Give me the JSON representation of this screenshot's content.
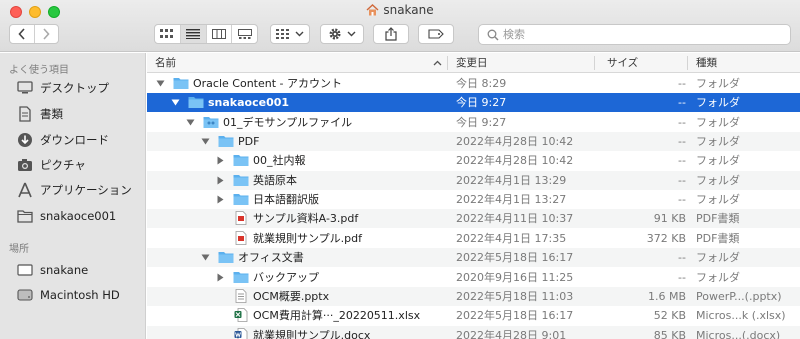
{
  "window": {
    "title": "snakane"
  },
  "toolbar": {
    "search_placeholder": "検索"
  },
  "sidebar": {
    "favorites_heading": "よく使う項目",
    "favorites": [
      {
        "label": "デスクトップ",
        "icon": "desktop-icon"
      },
      {
        "label": "書類",
        "icon": "document-icon"
      },
      {
        "label": "ダウンロード",
        "icon": "download-icon"
      },
      {
        "label": "ピクチャ",
        "icon": "camera-icon"
      },
      {
        "label": "アプリケーション",
        "icon": "applications-icon"
      },
      {
        "label": "snakaoce001",
        "icon": "folder-icon"
      }
    ],
    "locations_heading": "場所",
    "locations": [
      {
        "label": "snakane",
        "icon": "computer-icon"
      },
      {
        "label": "Macintosh HD",
        "icon": "disk-icon"
      }
    ]
  },
  "columns": {
    "name": "名前",
    "date": "変更日",
    "size": "サイズ",
    "kind": "種類"
  },
  "rows": [
    {
      "name": "Oracle Content - アカウント",
      "date": "今日 8:29",
      "size": "--",
      "kind": "フォルダ",
      "level": 0,
      "type": "folder",
      "disclosure": "open"
    },
    {
      "name": "snakaoce001",
      "date": "今日 9:27",
      "size": "--",
      "kind": "フォルダ",
      "level": 1,
      "type": "folder",
      "disclosure": "open",
      "selected": true
    },
    {
      "name": "01_デモサンプルファイル",
      "date": "今日 9:27",
      "size": "--",
      "kind": "フォルダ",
      "level": 2,
      "type": "folder-shared",
      "disclosure": "open"
    },
    {
      "name": "PDF",
      "date": "2022年4月28日 10:42",
      "size": "--",
      "kind": "フォルダ",
      "level": 3,
      "type": "folder",
      "disclosure": "open"
    },
    {
      "name": "00_社内報",
      "date": "2022年4月28日 10:42",
      "size": "--",
      "kind": "フォルダ",
      "level": 4,
      "type": "folder",
      "disclosure": "closed"
    },
    {
      "name": "英語原本",
      "date": "2022年4月1日 13:29",
      "size": "--",
      "kind": "フォルダ",
      "level": 4,
      "type": "folder",
      "disclosure": "closed"
    },
    {
      "name": "日本語翻訳版",
      "date": "2022年4月1日 13:27",
      "size": "--",
      "kind": "フォルダ",
      "level": 4,
      "type": "folder",
      "disclosure": "closed"
    },
    {
      "name": "サンプル資料A-3.pdf",
      "date": "2022年4月11日 10:37",
      "size": "91 KB",
      "kind": "PDF書類",
      "level": 4,
      "type": "pdf",
      "disclosure": "none"
    },
    {
      "name": "就業規則サンプル.pdf",
      "date": "2022年4月1日 17:35",
      "size": "372 KB",
      "kind": "PDF書類",
      "level": 4,
      "type": "pdf",
      "disclosure": "none"
    },
    {
      "name": "オフィス文書",
      "date": "2022年5月18日 16:17",
      "size": "--",
      "kind": "フォルダ",
      "level": 3,
      "type": "folder",
      "disclosure": "open"
    },
    {
      "name": "バックアップ",
      "date": "2020年9月16日 11:25",
      "size": "--",
      "kind": "フォルダ",
      "level": 4,
      "type": "folder",
      "disclosure": "closed"
    },
    {
      "name": "OCM概要.pptx",
      "date": "2022年5月18日 11:03",
      "size": "1.6 MB",
      "kind": "PowerP...(.pptx)",
      "level": 4,
      "type": "pptx",
      "disclosure": "none"
    },
    {
      "name": "OCM費用計算···_20220511.xlsx",
      "date": "2022年5月18日 16:17",
      "size": "52 KB",
      "kind": "Micros...k (.xlsx)",
      "level": 4,
      "type": "xlsx",
      "disclosure": "none"
    },
    {
      "name": "就業規則サンプル.docx",
      "date": "2022年4月28日 9:01",
      "size": "85 KB",
      "kind": "Micros...(.docx)",
      "level": 4,
      "type": "docx",
      "disclosure": "none"
    }
  ],
  "colors": {
    "selection": "#1d67d6",
    "folder": "#5bb0ee",
    "sidebar": "#e4e4e4"
  }
}
